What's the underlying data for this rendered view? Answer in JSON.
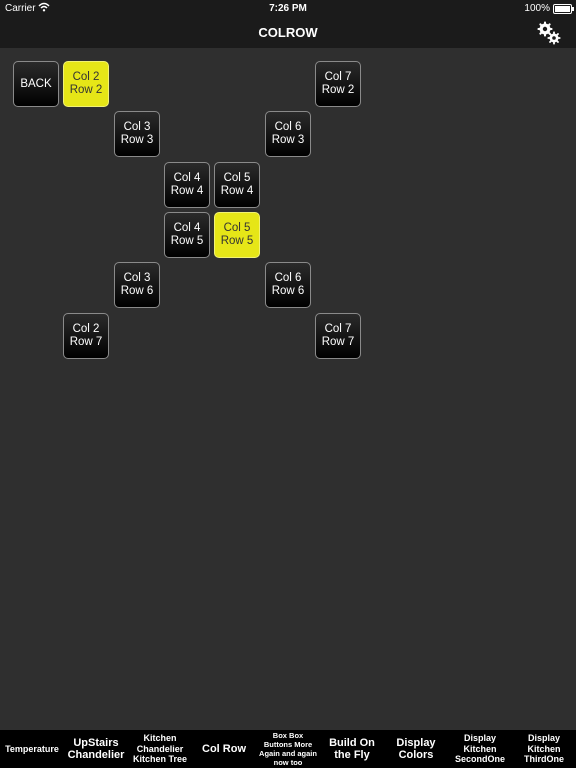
{
  "status_bar": {
    "carrier": "Carrier",
    "time": "7:26 PM",
    "battery": "100%"
  },
  "nav": {
    "title": "COLROW",
    "settings_icon": "gears-icon"
  },
  "back_label": "BACK",
  "colors": {
    "active": "#e6e617",
    "button_dark": "#000000",
    "background": "#2f2f2f"
  },
  "cells": [
    {
      "col": 2,
      "row": 2,
      "line1": "Col 2",
      "line2": "Row 2",
      "selected": true
    },
    {
      "col": 7,
      "row": 2,
      "line1": "Col 7",
      "line2": "Row 2",
      "selected": false
    },
    {
      "col": 3,
      "row": 3,
      "line1": "Col 3",
      "line2": "Row 3",
      "selected": false
    },
    {
      "col": 6,
      "row": 3,
      "line1": "Col 6",
      "line2": "Row 3",
      "selected": false
    },
    {
      "col": 4,
      "row": 4,
      "line1": "Col 4",
      "line2": "Row 4",
      "selected": false
    },
    {
      "col": 5,
      "row": 4,
      "line1": "Col 5",
      "line2": "Row 4",
      "selected": false
    },
    {
      "col": 4,
      "row": 5,
      "line1": "Col 4",
      "line2": "Row 5",
      "selected": false
    },
    {
      "col": 5,
      "row": 5,
      "line1": "Col 5",
      "line2": "Row 5",
      "selected": true
    },
    {
      "col": 3,
      "row": 6,
      "line1": "Col 3",
      "line2": "Row 6",
      "selected": false
    },
    {
      "col": 6,
      "row": 6,
      "line1": "Col 6",
      "line2": "Row 6",
      "selected": false
    },
    {
      "col": 2,
      "row": 7,
      "line1": "Col 2",
      "line2": "Row 7",
      "selected": false
    },
    {
      "col": 7,
      "row": 7,
      "line1": "Col 7",
      "line2": "Row 7",
      "selected": false
    }
  ],
  "tabs": [
    {
      "lines": [
        "Temperature"
      ]
    },
    {
      "lines": [
        "UpStairs",
        "Chandelier"
      ]
    },
    {
      "lines": [
        "Kitchen",
        "Chandelier",
        "Kitchen Tree"
      ]
    },
    {
      "lines": [
        "Col Row"
      ]
    },
    {
      "lines": [
        "Box Box",
        "Buttons More",
        "Again and again",
        "now too"
      ]
    },
    {
      "lines": [
        "Build On",
        "the Fly"
      ]
    },
    {
      "lines": [
        "Display",
        "Colors"
      ]
    },
    {
      "lines": [
        "Display",
        "Kitchen",
        "SecondOne"
      ]
    },
    {
      "lines": [
        "Display",
        "Kitchen",
        "ThirdOne"
      ]
    }
  ]
}
